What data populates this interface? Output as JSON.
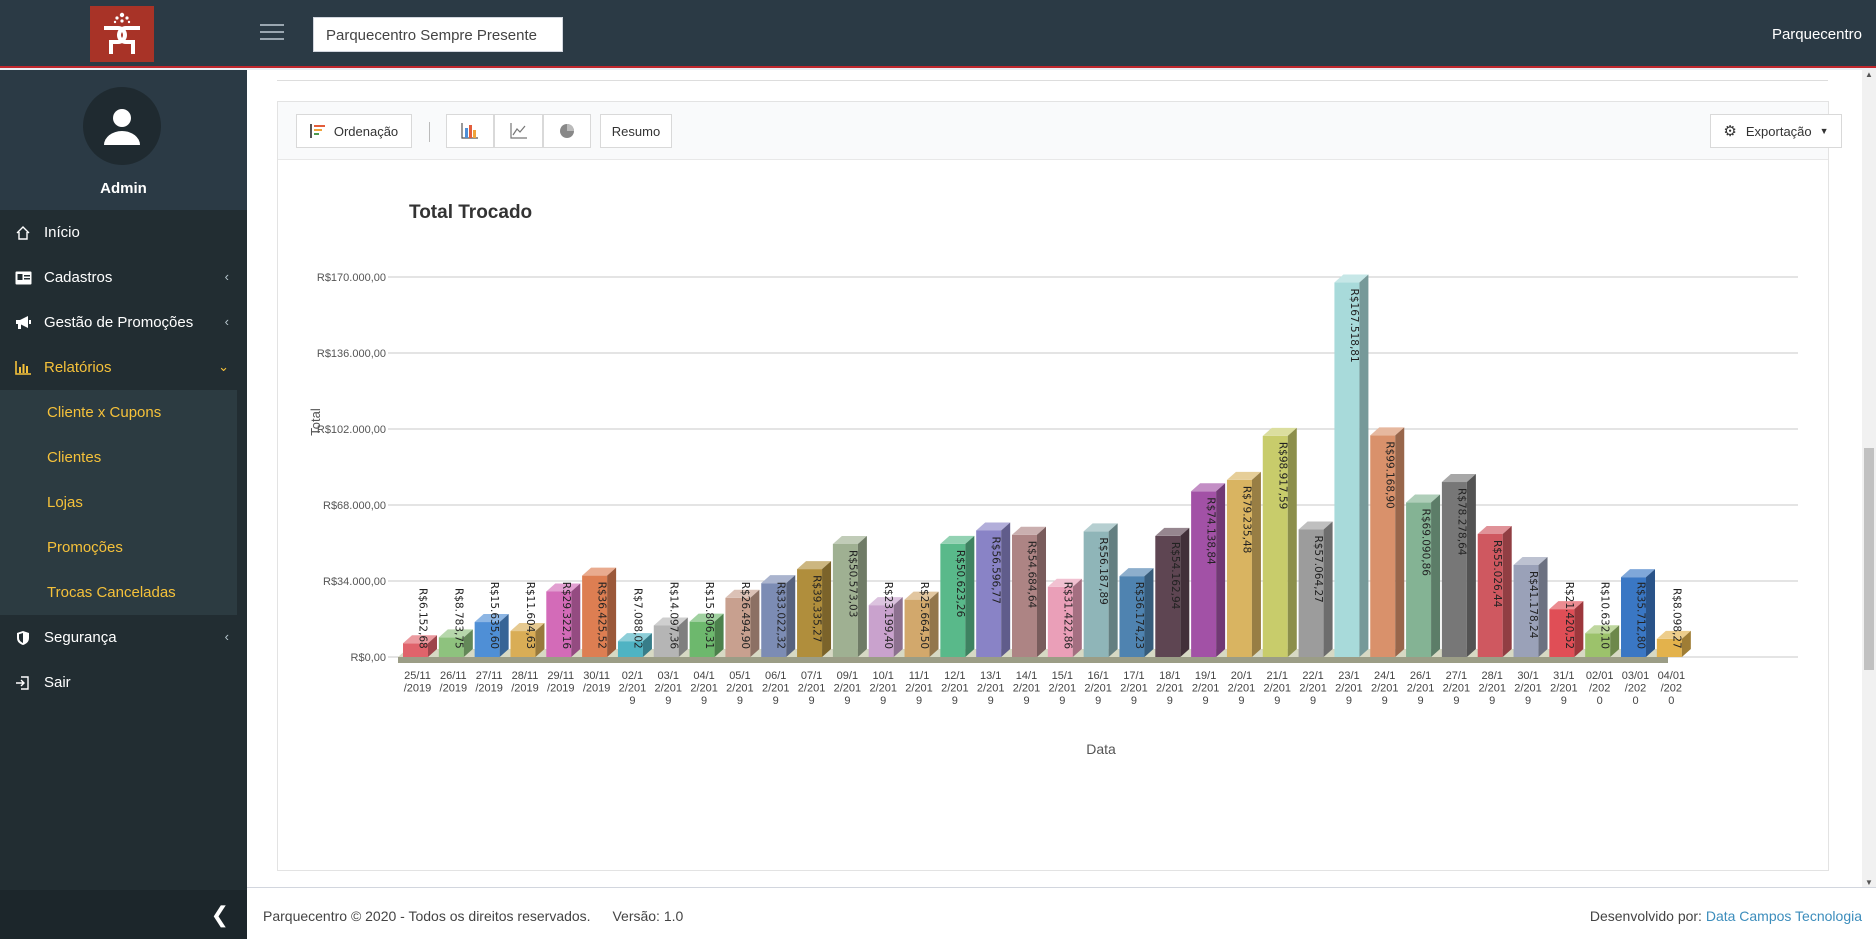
{
  "header": {
    "search_value": "Parquecentro Sempre Presente",
    "user_label": "Parquecentro"
  },
  "sidebar": {
    "user_name": "Admin",
    "items": [
      {
        "label": "Início",
        "icon": "home-icon"
      },
      {
        "label": "Cadastros",
        "icon": "id-card-icon"
      },
      {
        "label": "Gestão de Promoções",
        "icon": "megaphone-icon"
      },
      {
        "label": "Relatórios",
        "icon": "bar-chart-icon"
      },
      {
        "label": "Segurança",
        "icon": "shield-icon"
      },
      {
        "label": "Sair",
        "icon": "sign-out-icon"
      }
    ],
    "subitems": [
      "Cliente x Cupons",
      "Clientes",
      "Lojas",
      "Promoções",
      "Trocas Canceladas"
    ]
  },
  "toolbar": {
    "order_label": "Ordenação",
    "summary_label": "Resumo",
    "export_label": "Exportação"
  },
  "footer": {
    "copyright": "Parquecentro © 2020 - Todos os direitos reservados.",
    "version": "Versão: 1.0",
    "developed_by": "Desenvolvido por:",
    "developer": "Data Campos Tecnologia"
  },
  "colors": {
    "topbar": "#2b3a45",
    "sidebar": "#222d32",
    "accent_yellow": "#f5c13a",
    "brand_red": "#a83327",
    "link_blue": "#3c8dbc"
  },
  "chart_data": {
    "type": "bar",
    "title": "Total Trocado",
    "xlabel": "Data",
    "ylabel": "Total",
    "ylim": [
      0,
      170000
    ],
    "yticks": [
      "R$0,00",
      "R$34.000,00",
      "R$68.000,00",
      "R$102.000,00",
      "R$136.000,00",
      "R$170.000,00"
    ],
    "grid": true,
    "categories": [
      [
        "25/11",
        "/2019"
      ],
      [
        "26/11",
        "/2019"
      ],
      [
        "27/11",
        "/2019"
      ],
      [
        "28/11",
        "/2019"
      ],
      [
        "29/11",
        "/2019"
      ],
      [
        "30/11",
        "/2019"
      ],
      [
        "02/1",
        "2/201",
        "9"
      ],
      [
        "03/1",
        "2/201",
        "9"
      ],
      [
        "04/1",
        "2/201",
        "9"
      ],
      [
        "05/1",
        "2/201",
        "9"
      ],
      [
        "06/1",
        "2/201",
        "9"
      ],
      [
        "07/1",
        "2/201",
        "9"
      ],
      [
        "09/1",
        "2/201",
        "9"
      ],
      [
        "10/1",
        "2/201",
        "9"
      ],
      [
        "11/1",
        "2/201",
        "9"
      ],
      [
        "12/1",
        "2/201",
        "9"
      ],
      [
        "13/1",
        "2/201",
        "9"
      ],
      [
        "14/1",
        "2/201",
        "9"
      ],
      [
        "15/1",
        "2/201",
        "9"
      ],
      [
        "16/1",
        "2/201",
        "9"
      ],
      [
        "17/1",
        "2/201",
        "9"
      ],
      [
        "18/1",
        "2/201",
        "9"
      ],
      [
        "19/1",
        "2/201",
        "9"
      ],
      [
        "20/1",
        "2/201",
        "9"
      ],
      [
        "21/1",
        "2/201",
        "9"
      ],
      [
        "22/1",
        "2/201",
        "9"
      ],
      [
        "23/1",
        "2/201",
        "9"
      ],
      [
        "24/1",
        "2/201",
        "9"
      ],
      [
        "26/1",
        "2/201",
        "9"
      ],
      [
        "27/1",
        "2/201",
        "9"
      ],
      [
        "28/1",
        "2/201",
        "9"
      ],
      [
        "30/1",
        "2/201",
        "9"
      ],
      [
        "31/1",
        "2/201",
        "9"
      ],
      [
        "02/01",
        "/202",
        "0"
      ],
      [
        "03/01",
        "/202",
        "0"
      ],
      [
        "04/01",
        "/202",
        "0"
      ]
    ],
    "values": [
      6152.68,
      8783.75,
      15635.6,
      11604.63,
      29322.16,
      36425.52,
      7088.02,
      14097.36,
      15806.31,
      26494.9,
      33022.32,
      39335.27,
      50573.03,
      23199.4,
      25664.5,
      50623.26,
      56596.77,
      54684.64,
      31422.86,
      56187.89,
      36174.23,
      54162.94,
      74138.84,
      79235.48,
      98917.59,
      57064.27,
      167518.81,
      99168.9,
      69090.86,
      78278.64,
      55026.44,
      41178.24,
      21420.52,
      10632.1,
      35712.8,
      8098.27
    ],
    "labels": [
      "R$6.152,68",
      "R$8.783,75",
      "R$15.635,60",
      "R$11.604,63",
      "R$29.322,16",
      "R$36.425,52",
      "R$7.088,02",
      "R$14.097,36",
      "R$15.806,31",
      "R$26.494,90",
      "R$33.022,32",
      "R$39.335,27",
      "R$50.573,03",
      "R$23.199,40",
      "R$25.664,50",
      "R$50.623,26",
      "R$56.596,77",
      "R$54.684,64",
      "R$31.422,86",
      "R$56.187,89",
      "R$36.174,23",
      "R$54.162,94",
      "R$74.138,84",
      "R$79.235,48",
      "R$98.917,59",
      "R$57.064,27",
      "R$167.518,81",
      "R$99.168,90",
      "R$69.090,86",
      "R$78.278,64",
      "R$55.026,44",
      "R$41.178,24",
      "R$21.420,52",
      "R$10.632,10",
      "R$35.712,80",
      "R$8.098,27"
    ],
    "colors": [
      "#e0636b",
      "#8ec27e",
      "#4f8fd6",
      "#d9ad56",
      "#d36bb8",
      "#dd7e52",
      "#4fb3c3",
      "#b5b5b5",
      "#6db86d",
      "#c8a08f",
      "#7c8cb4",
      "#b08e3c",
      "#9fb092",
      "#c9a2cd",
      "#d2a86c",
      "#59b98a",
      "#8983c6",
      "#ad8484",
      "#ea9fb8",
      "#8fb5b8",
      "#4f83b0",
      "#5e4552",
      "#a251a6",
      "#d9b461",
      "#c8cc6b",
      "#9c9c9c",
      "#a8dada",
      "#d9916b",
      "#84b394",
      "#777777",
      "#cf5860",
      "#9aa1b8",
      "#e04e56",
      "#9cc26b",
      "#3a77c4",
      "#e3b24c"
    ]
  }
}
